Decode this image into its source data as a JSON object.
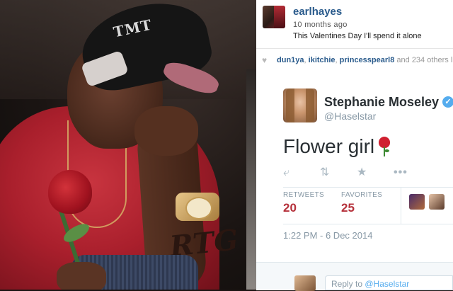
{
  "photo": {
    "cap_logo": "TMT",
    "tattoo_text": "RTG"
  },
  "instagram": {
    "username": "earlhayes",
    "time": "10 months ago",
    "caption": "This Valentines Day I'll spend it alone",
    "likes": {
      "users": [
        "dun1ya",
        "ikitchie",
        "princesspearl8"
      ],
      "separator": ",",
      "and_text": "and",
      "count": "234",
      "suffix": "others lik"
    },
    "icons": {
      "like": "heart-icon"
    }
  },
  "tweet": {
    "display_name": "Stephanie Moseley",
    "handle": "@Haselstar",
    "text": "Flower girl",
    "emoji": "rose",
    "verified_badge": "✓",
    "actions": {
      "reply": "reply-icon",
      "retweet": "retweet-icon",
      "favorite": "star-icon",
      "more": "more-icon"
    },
    "stats": {
      "retweets_label": "RETWEETS",
      "retweets": "20",
      "favorites_label": "FAVORITES",
      "favorites": "25"
    },
    "timestamp": "1:22 PM - 6 Dec 2014",
    "reply_box": {
      "prefix": "Reply to",
      "mention": "@Haselstar"
    },
    "colors": {
      "name": "#292f33",
      "muted": "#8899a6",
      "verified": "#55acee",
      "stat_value": "#b5303a"
    }
  }
}
